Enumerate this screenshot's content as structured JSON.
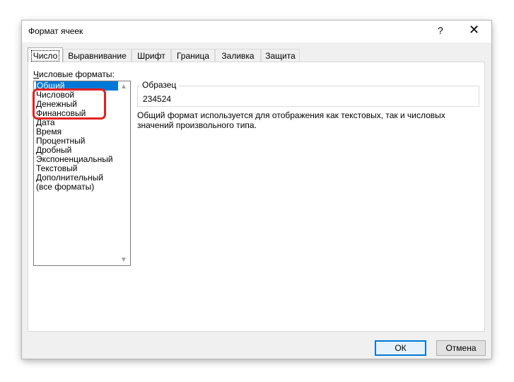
{
  "dialog": {
    "title": "Формат ячеек",
    "help": "?",
    "close": "✕"
  },
  "tabs": [
    {
      "label": "Число",
      "active": true
    },
    {
      "label": "Выравнивание",
      "active": false
    },
    {
      "label": "Шрифт",
      "active": false
    },
    {
      "label": "Граница",
      "active": false
    },
    {
      "label": "Заливка",
      "active": false
    },
    {
      "label": "Защита",
      "active": false
    }
  ],
  "formats": {
    "label": "Числовые форматы:",
    "items": [
      "Общий",
      "Числовой",
      "Денежный",
      "Финансовый",
      "Дата",
      "Время",
      "Процентный",
      "Дробный",
      "Экспоненциальный",
      "Текстовый",
      "Дополнительный",
      "(все форматы)"
    ],
    "selected": "Общий"
  },
  "sample": {
    "legend": "Образец",
    "value": "234524"
  },
  "description": "Общий формат используется для отображения как текстовых, так и числовых значений произвольного типа.",
  "buttons": {
    "ok": "ОК",
    "cancel": "Отмена"
  },
  "colors": {
    "accent": "#0078d7",
    "highlight": "#e52020"
  }
}
